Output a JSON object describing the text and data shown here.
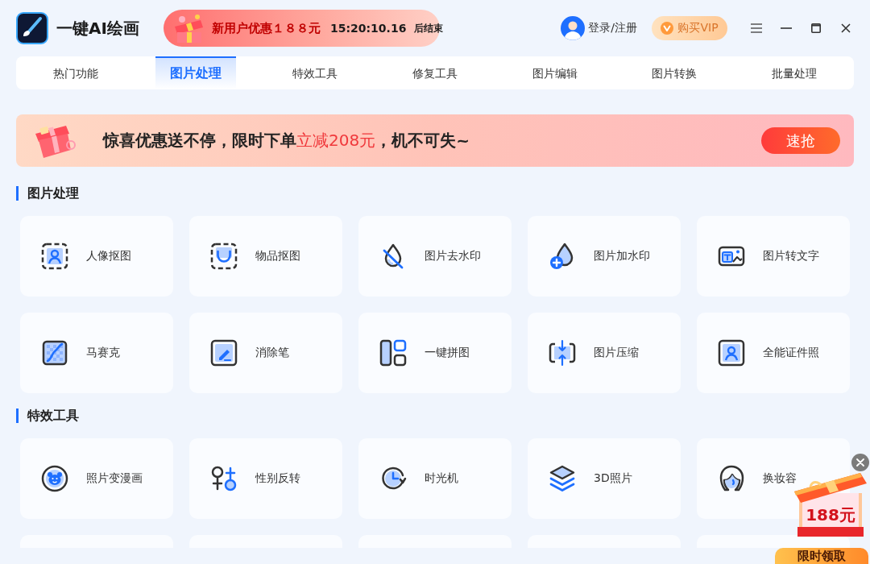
{
  "app": {
    "title": "一键AI绘画"
  },
  "promo": {
    "offer": "新用户优惠１８８元",
    "countdown": "15:20:10.16",
    "suffix": "后结束"
  },
  "account": {
    "login": "登录/注册",
    "vip_button": "购买VIP"
  },
  "tabs": [
    {
      "label": "热门功能",
      "selected": false
    },
    {
      "label": "图片处理",
      "selected": true
    },
    {
      "label": "特效工具",
      "selected": false
    },
    {
      "label": "修复工具",
      "selected": false
    },
    {
      "label": "图片编辑",
      "selected": false
    },
    {
      "label": "图片转换",
      "selected": false
    },
    {
      "label": "批量处理",
      "selected": false
    }
  ],
  "banner": {
    "text_before": "惊喜优惠送不停，限时下单",
    "highlight": "立减208元",
    "text_after": "，机不可失~",
    "button": "速抢"
  },
  "sections": [
    {
      "title": "图片处理",
      "items": [
        {
          "kind": "tool",
          "label": "人像抠图"
        },
        {
          "kind": "tool",
          "label": "物品抠图"
        },
        {
          "kind": "tool",
          "label": "图片去水印"
        },
        {
          "kind": "tool",
          "label": "图片加水印"
        },
        {
          "kind": "tool",
          "label": "图片转文字"
        },
        {
          "kind": "tool",
          "label": "马赛克"
        },
        {
          "kind": "tool",
          "label": "消除笔"
        },
        {
          "kind": "tool",
          "label": "一键拼图"
        },
        {
          "kind": "tool",
          "label": "图片压缩"
        },
        {
          "kind": "tool",
          "label": "全能证件照"
        }
      ]
    },
    {
      "title": "特效工具",
      "items": [
        {
          "kind": "tool",
          "label": "照片变漫画"
        },
        {
          "kind": "tool",
          "label": "性别反转"
        },
        {
          "kind": "tool",
          "label": "时光机"
        },
        {
          "kind": "tool",
          "label": "3D照片"
        },
        {
          "kind": "tool",
          "label": "换妆容"
        },
        {
          "kind": "cut_off"
        },
        {
          "kind": "cut_off"
        },
        {
          "kind": "cut_off"
        },
        {
          "kind": "cut_off"
        },
        {
          "kind": "cut_off"
        }
      ]
    }
  ],
  "gift_popup": {
    "amount": "188元",
    "button": "限时领取"
  }
}
